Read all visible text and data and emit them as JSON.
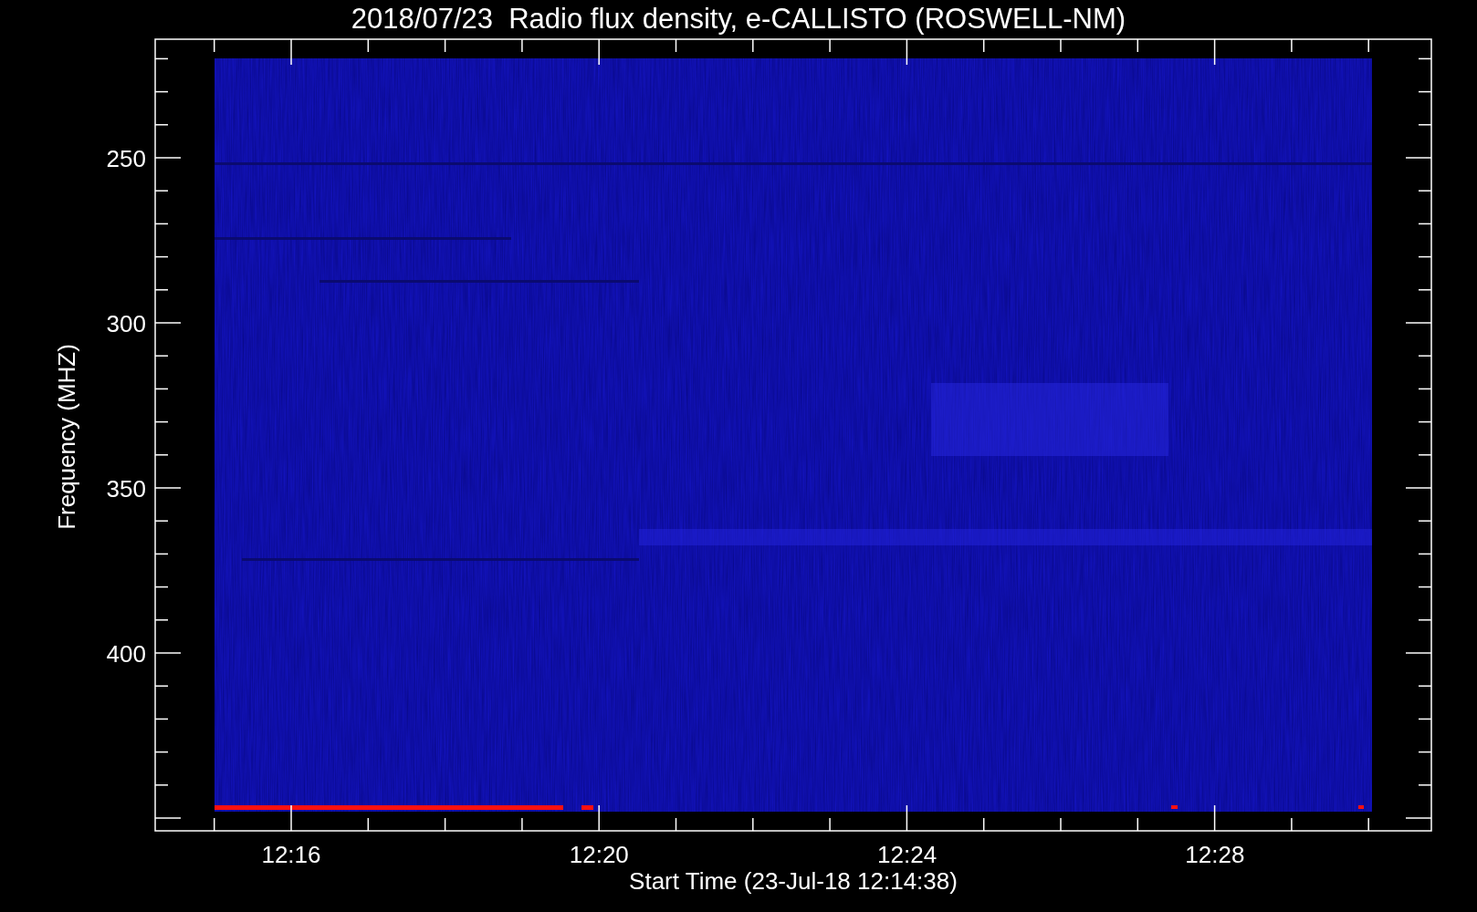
{
  "title": "2018/07/23  Radio flux density, e-CALLISTO (ROSWELL-NM)",
  "y_axis": {
    "label": "Frequency (MHZ)",
    "ticks": [
      "250",
      "300",
      "350",
      "400"
    ]
  },
  "x_axis": {
    "label": "Start Time (23-Jul-18 12:14:38)",
    "ticks": [
      "12:16",
      "12:20",
      "12:24",
      "12:28"
    ]
  }
}
